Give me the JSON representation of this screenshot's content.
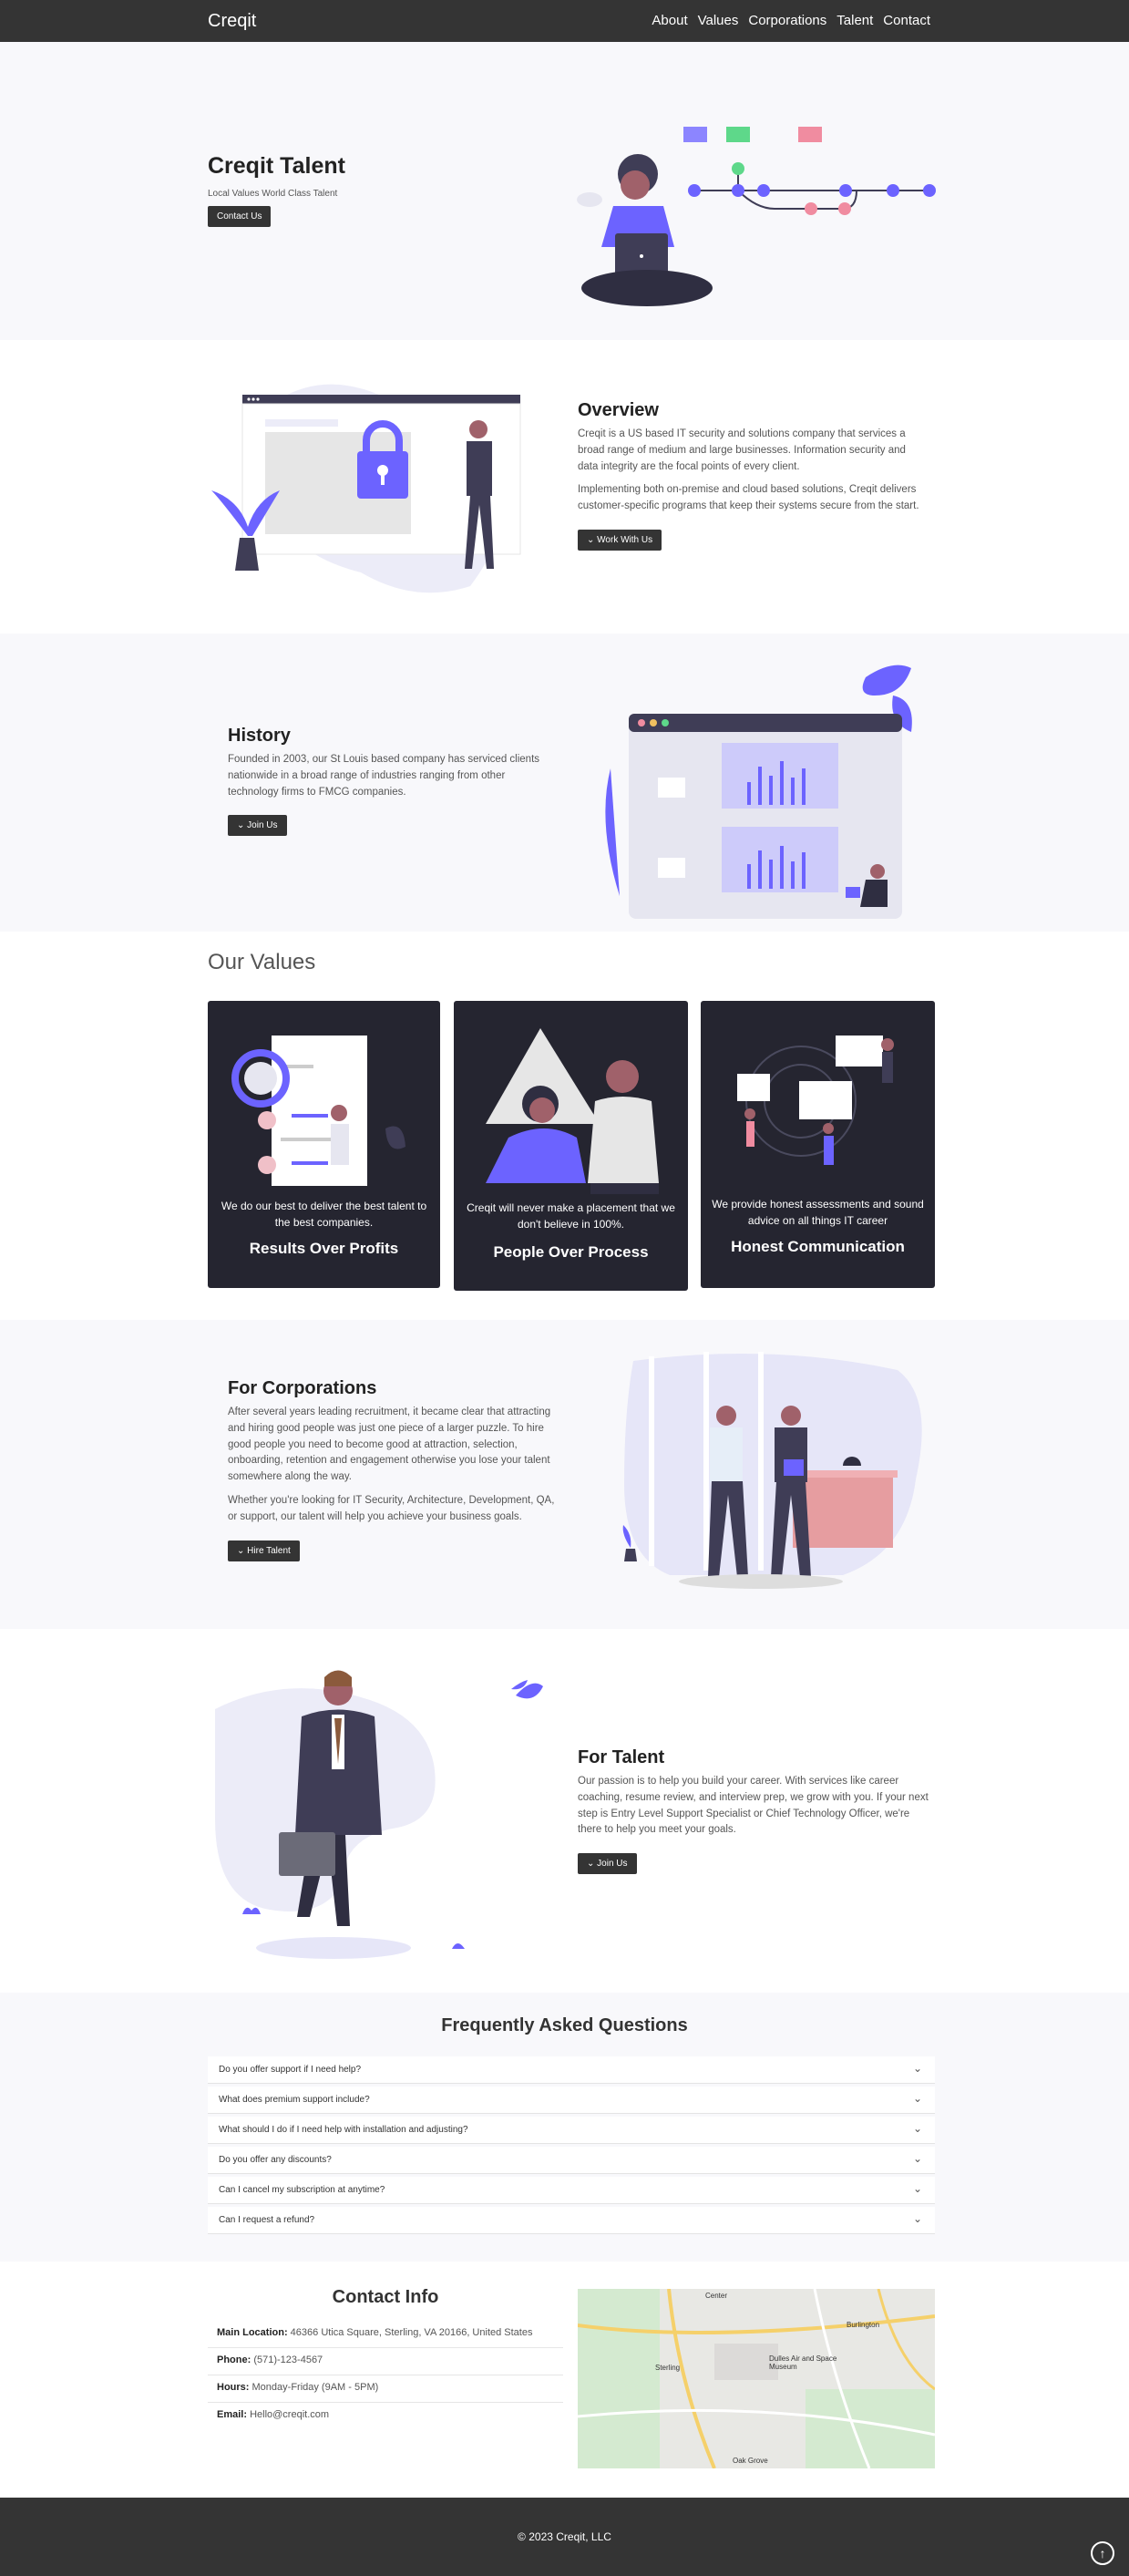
{
  "nav": {
    "brand": "Creqit",
    "links": [
      "About",
      "Values",
      "Corporations",
      "Talent",
      "Contact"
    ]
  },
  "hero": {
    "title": "Creqit Talent",
    "subtitle": "Local Values World Class Talent",
    "button": "Contact Us"
  },
  "overview": {
    "title": "Overview",
    "p1": "Creqit is a US based IT security and solutions company that services a broad range of medium and large businesses. Information security and data integrity are the focal points of every client.",
    "p2": "Implementing both on-premise and cloud based solutions, Creqit delivers customer-specific programs that keep their systems secure from the start.",
    "button": "Work With Us"
  },
  "history": {
    "title": "History",
    "p1": "Founded in 2003, our St Louis based company has serviced clients nationwide in a broad range of industries ranging from other technology firms to FMCG companies.",
    "button": "Join Us"
  },
  "values": {
    "title": "Our Values",
    "cards": [
      {
        "text": "We do our best to deliver the best talent to the best companies.",
        "caption": "Results Over Profits"
      },
      {
        "text": "Creqit will never make a placement that we don't believe in 100%.",
        "caption": "People Over Process"
      },
      {
        "text": "We provide honest assessments and sound advice on all things IT career",
        "caption": "Honest Communication"
      }
    ]
  },
  "corporations": {
    "title": "For Corporations",
    "p1": "After several years leading recruitment, it became clear that attracting and hiring good people was just one piece of a larger puzzle. To hire good people you need to become good at attraction, selection, onboarding, retention and engagement otherwise you lose your talent somewhere along the way.",
    "p2": "Whether you're looking for IT Security, Architecture, Development, QA, or support, our talent will help you achieve your business goals.",
    "button": "Hire Talent"
  },
  "talent": {
    "title": "For Talent",
    "p1": "Our passion is to help you build your career. With services like career coaching, resume review, and interview prep, we grow with you. If your next step is Entry Level Support Specialist or Chief Technology Officer, we're there to help you meet your goals.",
    "button": "Join Us"
  },
  "faq": {
    "title": "Frequently Asked Questions",
    "items": [
      "Do you offer support if I need help?",
      "What does premium support include?",
      "What should I do if I need help with installation and adjusting?",
      "Do you offer any discounts?",
      "Can I cancel my subscription at anytime?",
      "Can I request a refund?"
    ]
  },
  "contact": {
    "title": "Contact Info",
    "location_label": "Main Location:",
    "location": "46366 Utica Square, Sterling, VA 20166, United States",
    "phone_label": "Phone:",
    "phone": "(571)-123-4567",
    "hours_label": "Hours:",
    "hours": "Monday-Friday (9AM - 5PM)",
    "email_label": "Email:",
    "email": "Hello@creqit.com",
    "map_labels": [
      "Center",
      "Burlington",
      "Sterling",
      "Dulles Air and Space Museum",
      "Oak Grove"
    ]
  },
  "footer": {
    "copyright": "© 2023 Creqit, LLC"
  },
  "colors": {
    "accent": "#6c63ff",
    "dark": "#343434",
    "pink": "#f08ca0",
    "green": "#5ed88a"
  }
}
